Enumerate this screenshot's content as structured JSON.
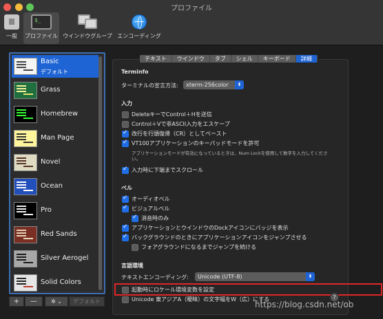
{
  "window": {
    "title": "プロファイル"
  },
  "toolbar": {
    "items": [
      {
        "label": "一般",
        "icon": "general-icon"
      },
      {
        "label": "プロファイル",
        "icon": "profile-icon"
      },
      {
        "label": "ウインドウグループ",
        "icon": "window-group-icon"
      },
      {
        "label": "エンコーディング",
        "icon": "encoding-globe-icon"
      }
    ],
    "active": "プロファイル"
  },
  "profiles": [
    {
      "name": "Basic",
      "subtitle": "デフォルト",
      "colors": [
        "#ffffff",
        "#ffffff"
      ]
    },
    {
      "name": "Grass",
      "colors": [
        "#f8f59d",
        "#e9e36b"
      ]
    },
    {
      "name": "Homebrew",
      "colors": [
        "#33ff33",
        "#33ff33"
      ]
    },
    {
      "name": "Man Page",
      "colors": [
        "#333333",
        "#333333"
      ]
    },
    {
      "name": "Novel",
      "colors": [
        "#553322",
        "#553322"
      ]
    },
    {
      "name": "Ocean",
      "colors": [
        "#ffffff",
        "#ffffff"
      ]
    },
    {
      "name": "Pro",
      "colors": [
        "#f2f2f2",
        "#f2f2f2"
      ]
    },
    {
      "name": "Red Sands",
      "colors": [
        "#e8d6b8",
        "#e8d6b8"
      ]
    },
    {
      "name": "Silver Aerogel",
      "colors": [
        "#1a1a1a",
        "#1a1a1a"
      ]
    },
    {
      "name": "Solid Colors",
      "colors": [
        "#222222",
        "#222222"
      ]
    }
  ],
  "profile_buttons": {
    "add": "+",
    "remove": "—",
    "gear": "✲ ⌄",
    "default": "デフォルト"
  },
  "tabs": [
    "テキスト",
    "ウインドウ",
    "タブ",
    "シェル",
    "キーボード",
    "詳細"
  ],
  "active_tab": "詳細",
  "terminfo": {
    "heading": "Terminfo",
    "declare_label": "ターミナルの宣言方法:",
    "declare_value": "xterm-256color"
  },
  "input": {
    "heading": "入力",
    "options": [
      {
        "label": "DeleteキーでControl＋Hを送信",
        "checked": false
      },
      {
        "label": "Control＋Vで非ASCII入力をエスケープ",
        "checked": false
      },
      {
        "label": "改行を行頭復帰（CR）としてペースト",
        "checked": true
      },
      {
        "label": "VT100アプリケーションのキーパッドモードを許可",
        "checked": true
      }
    ],
    "keypad_note": "アプリケーションモードが有効になっているときは、Num Lockを使用して数字を入力してください。",
    "scroll_option": {
      "label": "入力時に下端までスクロール",
      "checked": true
    }
  },
  "bell": {
    "heading": "ベル",
    "audio": {
      "label": "オーディオベル",
      "checked": true
    },
    "visual": {
      "label": "ビジュアルベル",
      "checked": true
    },
    "mute_only": {
      "label": "消音時のみ",
      "checked": true
    },
    "dock_badge": {
      "label": "アプリケーションとウインドウのDockアイコンにバッジを表示",
      "checked": true
    },
    "bounce": {
      "label": "バックグラウンドのときにアプリケーションアイコンをジャンプさせる",
      "checked": true
    },
    "foreground": {
      "label": "フォアグラウンドになるまでジャンプを続ける",
      "checked": false
    }
  },
  "international": {
    "heading": "言語環境",
    "encoding_label": "テキストエンコーディング:",
    "encoding_value": "Unicode (UTF-8)",
    "locale_option": {
      "label": "起動時にロケール環境変数を設定",
      "checked": false
    },
    "east_asian": {
      "label": "Unicode 東アジアA（曖昧）の文字幅をW（広）にする",
      "checked": false
    }
  },
  "help": "?",
  "watermark": "https://blog.csdn.net/ob",
  "colors": {
    "accent": "#1f64d4",
    "highlight_box": "#e0262a"
  }
}
